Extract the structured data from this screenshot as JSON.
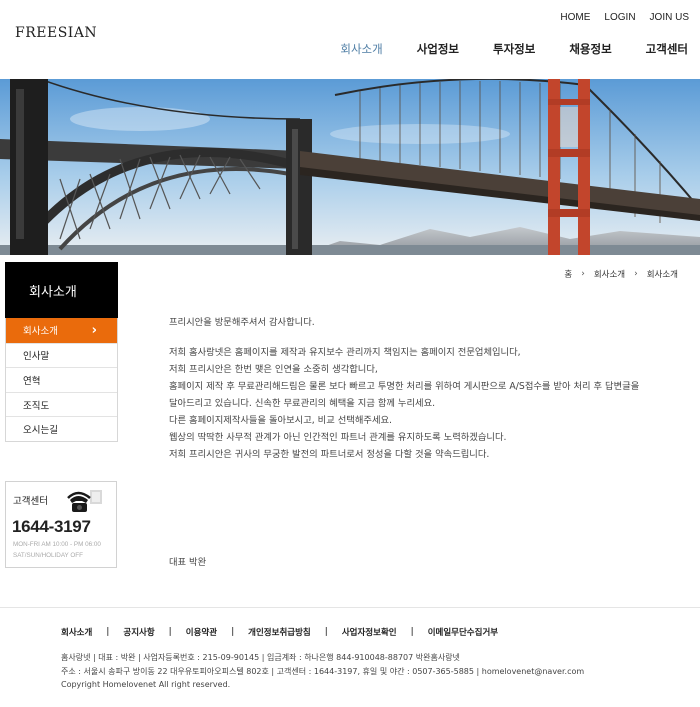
{
  "header": {
    "logo": "FREESIAN",
    "util_nav": [
      "HOME",
      "LOGIN",
      "JOIN US"
    ],
    "main_nav": [
      {
        "label": "회사소개",
        "active": true
      },
      {
        "label": "사업정보",
        "active": false
      },
      {
        "label": "투자정보",
        "active": false
      },
      {
        "label": "채용정보",
        "active": false
      },
      {
        "label": "고객센터",
        "active": false
      }
    ],
    "accent_color": "#4f7ea5"
  },
  "sidebar": {
    "title": "회사소개",
    "items": [
      {
        "label": "회사소개",
        "active": true
      },
      {
        "label": "인사말",
        "active": false
      },
      {
        "label": "연혁",
        "active": false
      },
      {
        "label": "조직도",
        "active": false
      },
      {
        "label": "오시는길",
        "active": false
      }
    ],
    "active_color": "#ea6b0c",
    "customer_center": {
      "title": "고객센터",
      "phone": "1644-3197",
      "hours_line1": "MON-FRI AM 10:00 - PM 06:00",
      "hours_line2": "SAT/SUN/HOLIDAY OFF",
      "icon": "telephone-icon"
    }
  },
  "breadcrumb": [
    "홈",
    "회사소개",
    "회사소개"
  ],
  "content": {
    "greeting": "프리시안을 방문해주셔서 감사합니다.",
    "lines": [
      "저희 홈사랑넷은 홈페이지를 제작과 유지보수 관리까지 책임지는 홈페이지 전문업체입니다,",
      "저희 프리시안은 한번 맺은 인연을 소중히 생각합니다,",
      "홈페이지 제작 후 무료관리해드림은 물론 보다 빠르고 투명한 처리를 위하여 게시판으로 A/S접수를  받아 처리 후 답변글을",
      "달아드리고 있습니다. 신속한 무료관리의 혜택을 지금 함께 누리세요.",
      "다른 홈페이지제작사들을 돌아보시고, 비교 선택해주세요.",
      "웹상의 딱딱한 사무적 관계가 아닌 인간적인 파트너 관계를 유지하도록 노력하겠습니다.",
      "저희 프리시안은 귀사의 무궁한 발전의 파트너로서 정성을 다할 것을 약속드립니다."
    ],
    "ceo": "대표 박완"
  },
  "footer": {
    "nav": [
      "회사소개",
      "공지사항",
      "이용약관",
      "개인정보취급방침",
      "사업자정보확인",
      "이메일무단수집거부"
    ],
    "info_line1": "홈사랑넷  |  대표 : 박완  |  사업자등록번호 : 215-09-90145  |  입금계좌 : 하나은행 844-910048-88707 박완홈사랑넷",
    "info_line2": "주소 : 서울시 송파구 방이동 22 대우유토피아오피스텔 802호  |  고객센터 : 1644-3197, 휴일 및 야간 : 0507-365-5885  |  homelovenet@naver.com",
    "copyright": "Copyright Homelovenet All right reserved."
  }
}
